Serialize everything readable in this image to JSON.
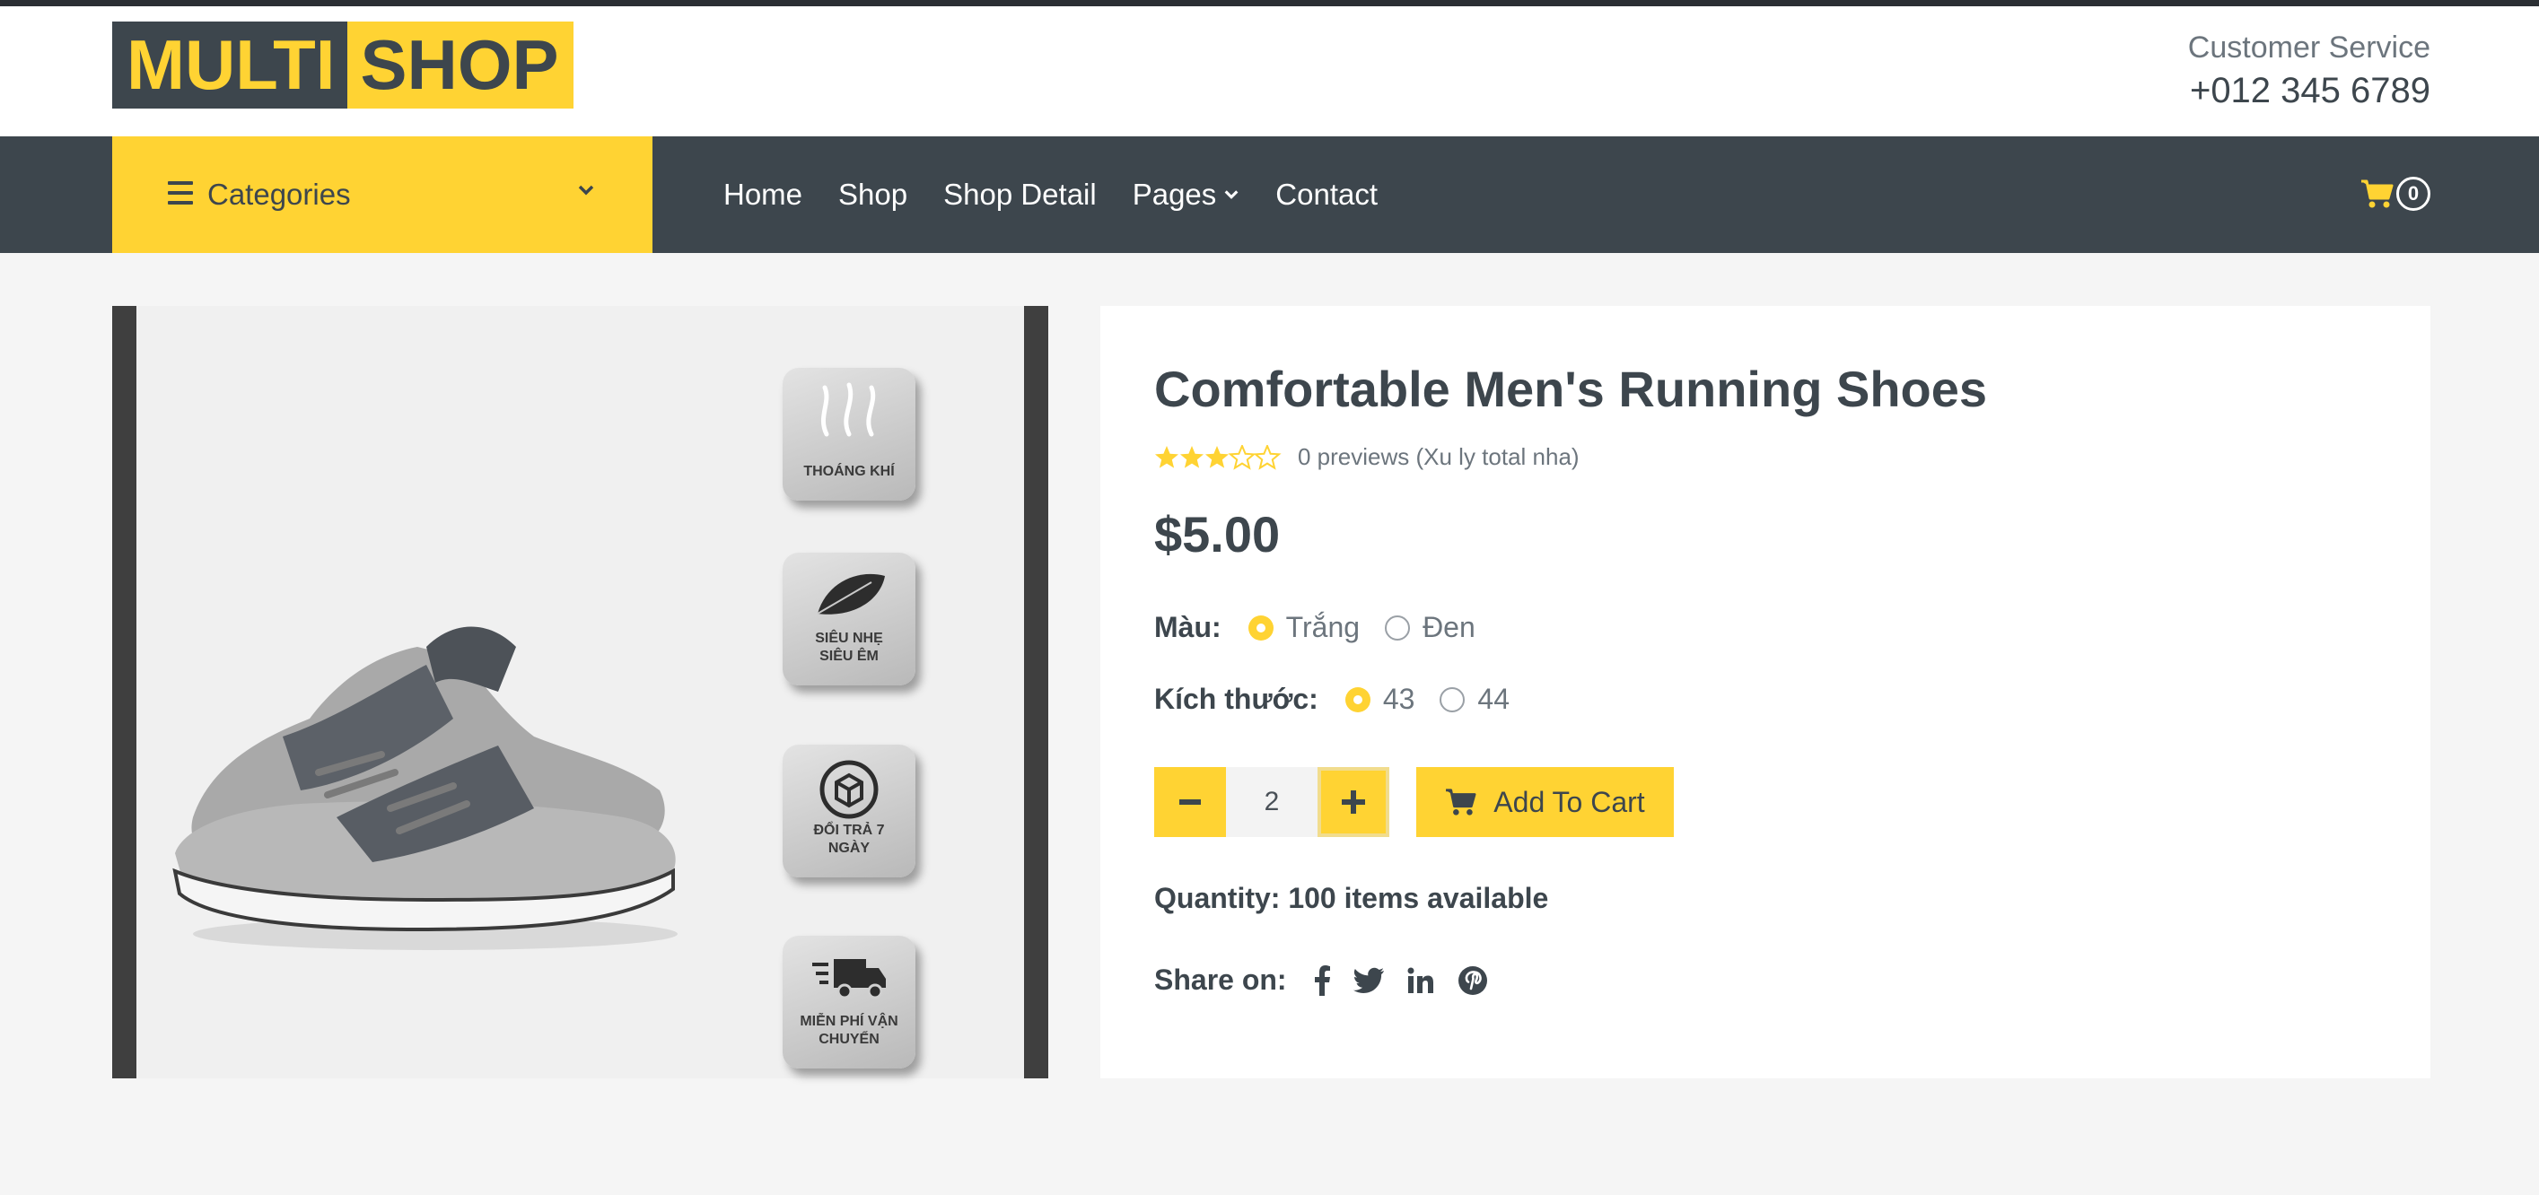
{
  "brand": {
    "part1": "MULTI",
    "part2": "SHOP"
  },
  "customer_service": {
    "label": "Customer Service",
    "phone": "+012 345 6789"
  },
  "nav": {
    "categories_label": "Categories",
    "links": [
      "Home",
      "Shop",
      "Shop Detail",
      "Pages",
      "Contact"
    ],
    "cart_count": "0"
  },
  "product": {
    "title": "Comfortable Men's Running Shoes",
    "rating": 3.5,
    "reviews_text": "0 previews (Xu ly total nha)",
    "price": "$5.00",
    "color_label": "Màu:",
    "colors": [
      "Trắng",
      "Đen"
    ],
    "size_label": "Kích thước:",
    "sizes": [
      "43",
      "44"
    ],
    "quantity": "2",
    "add_to_cart": "Add To Cart",
    "availability": "Quantity: 100 items available",
    "share_label": "Share on:"
  },
  "image_badges": [
    "THOÁNG KHÍ",
    "SIÊU NHẸ SIÊU ÊM",
    "ĐỔI TRẢ 7 NGÀY",
    "MIỄN PHÍ VẬN CHUYỂN"
  ],
  "colors": {
    "accent": "#FFD333",
    "dark": "#3D464D"
  }
}
